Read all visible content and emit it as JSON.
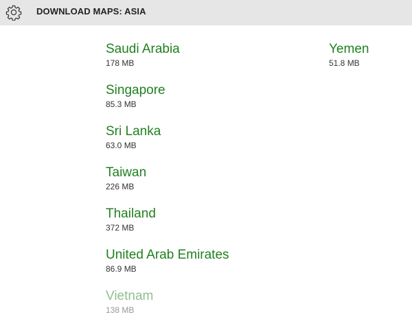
{
  "header": {
    "title": "DOWNLOAD MAPS: ASIA",
    "icon": "gear-icon"
  },
  "colors": {
    "accent": "#208020",
    "accent_disabled": "#8fbf8f",
    "header_bg": "#e6e6e6"
  },
  "columns": [
    {
      "items": [
        {
          "name": "Saudi Arabia",
          "size": "178 MB"
        },
        {
          "name": "Singapore",
          "size": "85.3 MB"
        },
        {
          "name": "Sri Lanka",
          "size": "63.0 MB"
        },
        {
          "name": "Taiwan",
          "size": "226 MB"
        },
        {
          "name": "Thailand",
          "size": "372 MB"
        },
        {
          "name": "United Arab Emirates",
          "size": "86.9 MB"
        },
        {
          "name": "Vietnam",
          "size": "138 MB",
          "disabled": true
        }
      ]
    },
    {
      "items": [
        {
          "name": "Yemen",
          "size": "51.8 MB"
        }
      ]
    }
  ]
}
